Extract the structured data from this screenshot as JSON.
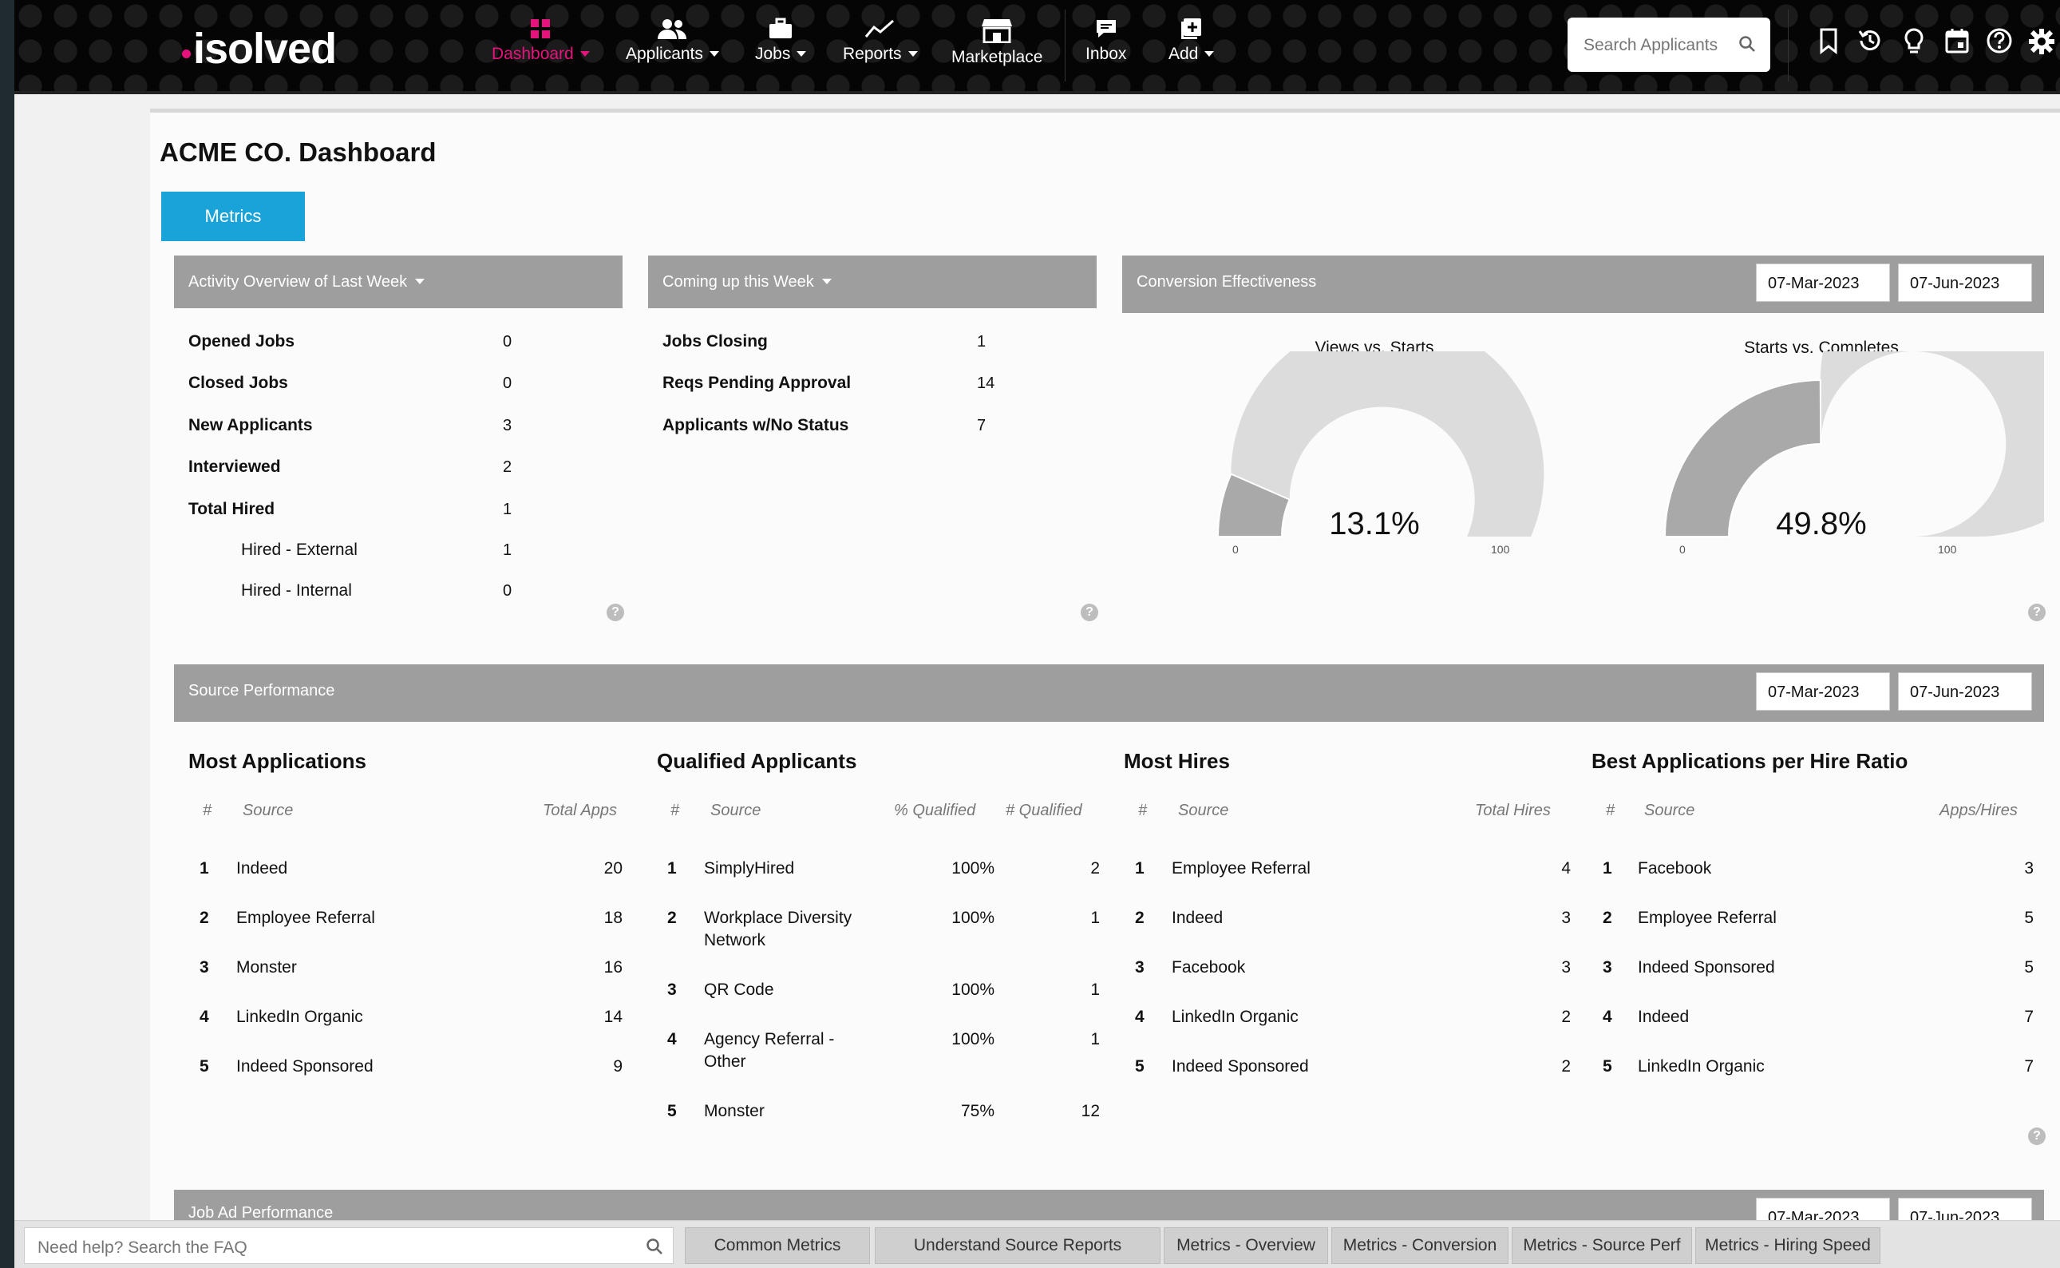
{
  "nav": {
    "logo": "isolved",
    "items": [
      {
        "label": "Dashboard",
        "icon": "dashboard-icon",
        "active": true,
        "caret": true
      },
      {
        "label": "Applicants",
        "icon": "people-icon",
        "caret": true
      },
      {
        "label": "Jobs",
        "icon": "briefcase-icon",
        "caret": true
      },
      {
        "label": "Reports",
        "icon": "chart-line-icon",
        "caret": true
      },
      {
        "label": "Marketplace",
        "icon": "store-icon",
        "caret": false
      },
      {
        "label": "Inbox",
        "icon": "inbox-icon",
        "caret": false
      },
      {
        "label": "Add",
        "icon": "add-icon",
        "caret": true
      }
    ],
    "search_placeholder": "Search Applicants",
    "utility_icons": [
      "bookmark-icon",
      "history-icon",
      "lightbulb-icon",
      "calendar-icon",
      "help-icon",
      "gear-icon"
    ],
    "accent_color": "#e8127c"
  },
  "page": {
    "title": "ACME CO. Dashboard",
    "tab": "Metrics",
    "tab_color": "#1aa3d9"
  },
  "activity": {
    "title": "Activity Overview of Last Week",
    "rows": [
      {
        "label": "Opened Jobs",
        "value": "0"
      },
      {
        "label": "Closed Jobs",
        "value": "0"
      },
      {
        "label": "New Applicants",
        "value": "3"
      },
      {
        "label": "Interviewed",
        "value": "2"
      },
      {
        "label": "Total Hired",
        "value": "1"
      },
      {
        "label": "Hired - External",
        "value": "1"
      },
      {
        "label": "Hired - Internal",
        "value": "0"
      }
    ]
  },
  "coming": {
    "title": "Coming up this Week",
    "rows": [
      {
        "label": "Jobs Closing",
        "value": "1"
      },
      {
        "label": "Reqs Pending Approval",
        "value": "14"
      },
      {
        "label": "Applicants w/No Status",
        "value": "7"
      }
    ]
  },
  "conversion": {
    "title": "Conversion Effectiveness",
    "date_from": "07-Mar-2023",
    "date_to": "07-Jun-2023",
    "gauges": [
      {
        "title": "Views vs. Starts",
        "value_label": "13.1%",
        "percent": 13.1,
        "min": "0",
        "max": "100"
      },
      {
        "title": "Starts vs. Completes",
        "value_label": "49.8%",
        "percent": 49.8,
        "min": "0",
        "max": "100"
      }
    ]
  },
  "source": {
    "title": "Source Performance",
    "date_from": "07-Mar-2023",
    "date_to": "07-Jun-2023",
    "most_applications": {
      "title": "Most Applications",
      "headers": [
        "#",
        "Source",
        "Total Apps"
      ],
      "rows": [
        [
          "1",
          "Indeed",
          "20"
        ],
        [
          "2",
          "Employee Referral",
          "18"
        ],
        [
          "3",
          "Monster",
          "16"
        ],
        [
          "4",
          "LinkedIn Organic",
          "14"
        ],
        [
          "5",
          "Indeed Sponsored",
          "9"
        ]
      ]
    },
    "qualified": {
      "title": "Qualified Applicants",
      "headers": [
        "#",
        "Source",
        "% Qualified",
        "# Qualified"
      ],
      "rows": [
        [
          "1",
          "SimplyHired",
          "",
          "100%",
          "2"
        ],
        [
          "2",
          "Workplace Diversity",
          "Network",
          "100%",
          "1"
        ],
        [
          "3",
          "QR Code",
          "",
          "100%",
          "1"
        ],
        [
          "4",
          "Agency Referral -",
          "Other",
          "100%",
          "1"
        ],
        [
          "5",
          "Monster",
          "",
          "75%",
          "12"
        ]
      ]
    },
    "most_hires": {
      "title": "Most Hires",
      "headers": [
        "#",
        "Source",
        "Total Hires"
      ],
      "rows": [
        [
          "1",
          "Employee Referral",
          "4"
        ],
        [
          "2",
          "Indeed",
          "3"
        ],
        [
          "3",
          "Facebook",
          "3"
        ],
        [
          "4",
          "LinkedIn Organic",
          "2"
        ],
        [
          "5",
          "Indeed Sponsored",
          "2"
        ]
      ]
    },
    "best_ratio": {
      "title": "Best Applications per Hire Ratio",
      "headers": [
        "#",
        "Source",
        "Apps/Hires"
      ],
      "rows": [
        [
          "1",
          "Facebook",
          "3"
        ],
        [
          "2",
          "Employee Referral",
          "5"
        ],
        [
          "3",
          "Indeed Sponsored",
          "5"
        ],
        [
          "4",
          "Indeed",
          "7"
        ],
        [
          "5",
          "LinkedIn Organic",
          "7"
        ]
      ]
    }
  },
  "job_ad": {
    "title": "Job Ad Performance"
  },
  "footer": {
    "faq_placeholder": "Need help? Search the FAQ",
    "buttons": [
      "Common Metrics Questions",
      "Understand Source Reports",
      "Metrics - Overview",
      "Metrics - Conversion",
      "Metrics - Source Perf",
      "Metrics - Hiring Speed"
    ]
  }
}
